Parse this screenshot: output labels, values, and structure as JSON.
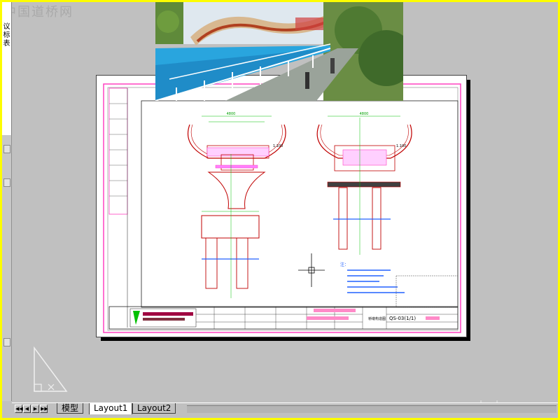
{
  "watermark": {
    "top": "中国道桥网",
    "bottom": "www.cnbdw.com"
  },
  "left_panel": {
    "text": "议标表"
  },
  "tabs": [
    {
      "label": "模型",
      "active": false
    },
    {
      "label": "Layout1",
      "active": true
    },
    {
      "label": "Layout2",
      "active": false
    }
  ],
  "nav_buttons": [
    "◀◀",
    "◀",
    "▶",
    "▶▶"
  ],
  "drawing": {
    "title_block_label": "桥墩构造图",
    "drawing_no": "QS-03(1/1)",
    "elev_left": "1.100",
    "elev_right": "1.100",
    "dim_top_left": "4800",
    "dim_top_right": "4800",
    "notes_heading": "注："
  },
  "colors": {
    "paper": "#ffffff",
    "frame_magenta": "#ff40c0",
    "line_red": "#c00000",
    "dim_green": "#00c000",
    "ann_blue": "#2060ff",
    "background": "#c0c0c0",
    "outer_border": "#fdfd00"
  }
}
